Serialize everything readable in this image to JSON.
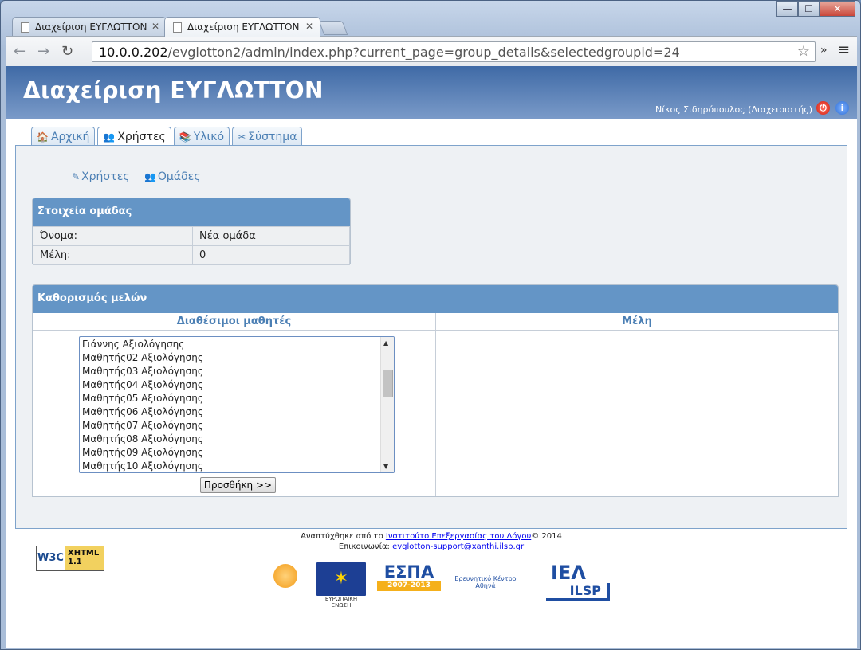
{
  "browser": {
    "tabs": [
      {
        "label": "Διαχείριση ΕΥΓΛΩΤΤΟΝ",
        "close": "✕"
      },
      {
        "label": "Διαχείριση ΕΥΓΛΩΤΤΟΝ",
        "close": "✕"
      }
    ],
    "url_host": "10.0.0.202",
    "url_path": "/evglotton2/admin/index.php?current_page=group_details&selectedgroupid=24"
  },
  "header": {
    "title": "Διαχείριση ΕΥΓΛΩΤΤΟΝ",
    "user": "Νίκος Σιδηρόπουλος (Διαχειριστής)"
  },
  "nav_tabs": [
    {
      "label": "Αρχική",
      "icon": "home-icon"
    },
    {
      "label": "Χρήστες",
      "icon": "users-icon"
    },
    {
      "label": "Υλικό",
      "icon": "material-icon"
    },
    {
      "label": "Σύστημα",
      "icon": "tools-icon"
    }
  ],
  "sub_links": [
    {
      "label": "Χρήστες"
    },
    {
      "label": "Ομάδες"
    }
  ],
  "group_details": {
    "title": "Στοιχεία ομάδας",
    "rows": [
      {
        "label": "Όνομα:",
        "value": "Νέα ομάδα"
      },
      {
        "label": "Μέλη:",
        "value": "0"
      }
    ]
  },
  "members": {
    "title": "Καθορισμός μελών",
    "available_header": "Διαθέσιμοι μαθητές",
    "members_header": "Μέλη",
    "available": [
      "Γιάννης Αξιολόγησης",
      "Μαθητής02 Αξιολόγησης",
      "Μαθητής03 Αξιολόγησης",
      "Μαθητής04 Αξιολόγησης",
      "Μαθητής05 Αξιολόγησης",
      "Μαθητής06 Αξιολόγησης",
      "Μαθητής07 Αξιολόγησης",
      "Μαθητής08 Αξιολόγησης",
      "Μαθητής09 Αξιολόγησης",
      "Μαθητής10 Αξιολόγησης"
    ],
    "add_button": "Προσθήκη >>"
  },
  "footer": {
    "dev_prefix": "Αναπτύχθηκε από το ",
    "dev_link": "Ινστιτούτο Επεξεργασίας του Λόγου",
    "dev_suffix": "© 2014",
    "contact_prefix": "Επικοινωνία: ",
    "contact_link": "evglotton-support@xanthi.ilsp.gr",
    "w3c_left": "W3C",
    "w3c_right": "XHTML 1.1",
    "logo_eu_text": "ΕΥΡΩΠΑΪΚΗ ΕΝΩΣΗ",
    "logo_espa_title": "ΕΣΠΑ",
    "logo_espa_years": "2007-2013",
    "logo_athena_text": "Ερευνητικό Κέντρο Αθηνά",
    "logo_iel": "ΙΕΛ",
    "logo_ilsp": "ILSP"
  },
  "colors": {
    "banner": "#4a74ae",
    "panel_header": "#6495c6",
    "link": "#4b7fb4"
  }
}
